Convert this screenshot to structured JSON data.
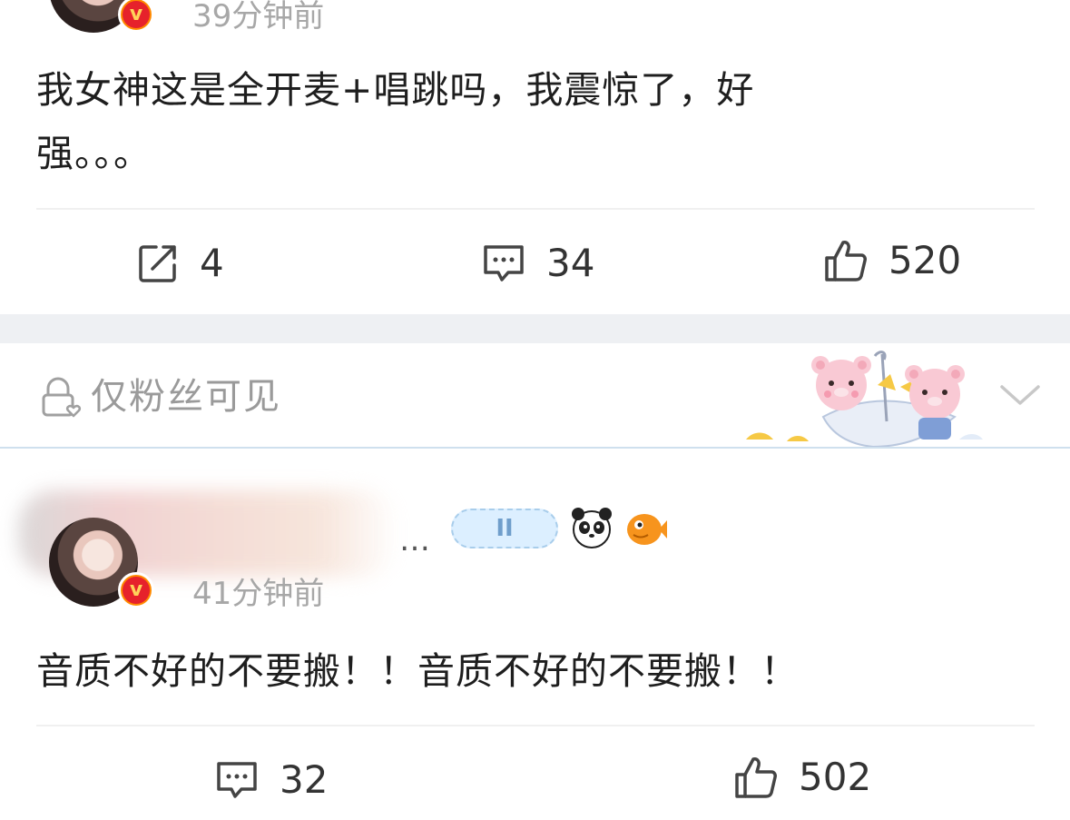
{
  "comments": [
    {
      "time": "39分钟前",
      "text_line1": "我女神这是全开麦+唱跳吗，我震惊了，好",
      "text_line2": "强。。。",
      "actions": {
        "repost_count": "4",
        "comment_count": "34",
        "like_count": "520"
      }
    },
    {
      "time": "41分钟前",
      "ellipsis": "…",
      "badge_label": "II",
      "text": "音质不好的不要搬！！音质不好的不要搬！！",
      "actions": {
        "comment_count": "32",
        "like_count": "502"
      }
    }
  ],
  "visibility": {
    "label": "仅粉丝可见",
    "icon": "lock-icon"
  },
  "icons": {
    "repost": "repost-icon",
    "comment": "comment-icon",
    "like": "like-icon",
    "expand": "chevron-down-icon",
    "verified": "verified-badge-icon"
  },
  "colors": {
    "verified_outer": "#ff8a00",
    "verified_inner": "#e6222b",
    "muted_text": "#a7a7a7",
    "separator_band": "#eef0f3"
  }
}
